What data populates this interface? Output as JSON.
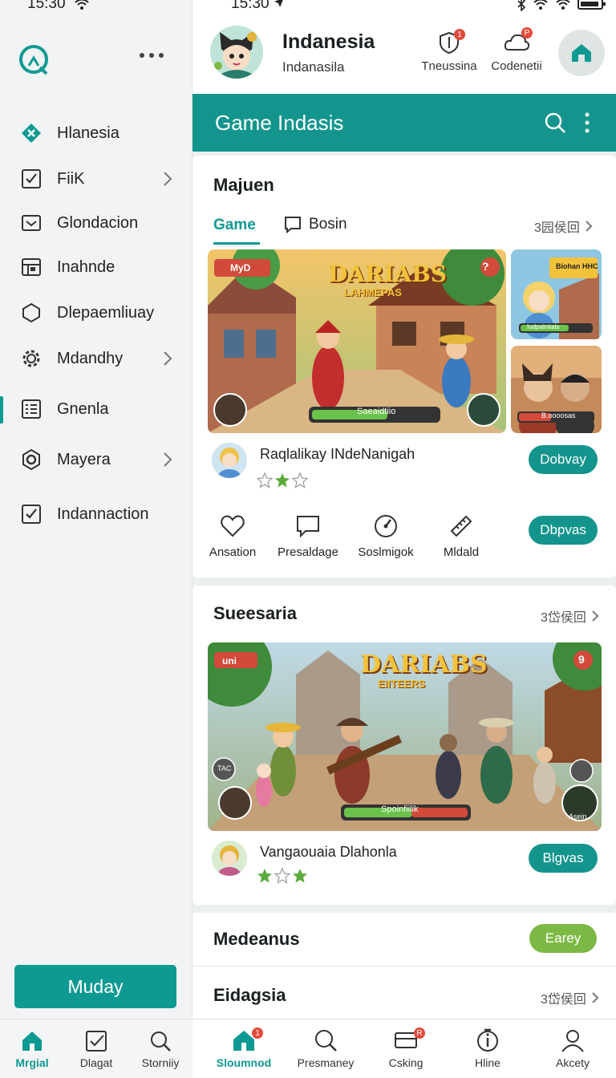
{
  "status_left": {
    "time": "15:30"
  },
  "status_right": {
    "time": "15:30"
  },
  "sidebar": {
    "items": [
      {
        "label": "Hlanesia",
        "icon": "puzzle-icon"
      },
      {
        "label": "FiiK",
        "icon": "checkbox-icon"
      },
      {
        "label": "Glondacion",
        "icon": "inbox-icon"
      },
      {
        "label": "Inahnde",
        "icon": "layout-icon"
      },
      {
        "label": "Dlepaemliuay",
        "icon": "hexagon-icon"
      },
      {
        "label": "Mdandhy",
        "icon": "gear-icon"
      },
      {
        "label": "Gnenla",
        "icon": "list-icon"
      },
      {
        "label": "Mayera",
        "icon": "settings-icon"
      },
      {
        "label": "Indannaction",
        "icon": "checkbox-icon"
      }
    ],
    "cta": "Muday"
  },
  "left_bottom_nav": [
    {
      "label": "Mrgial",
      "icon": "home-icon"
    },
    {
      "label": "Dlagat",
      "icon": "check-square-icon"
    },
    {
      "label": "Storniiy",
      "icon": "search-icon"
    }
  ],
  "header": {
    "title": "Indanesia",
    "subtitle": "Indanasila",
    "actions": [
      {
        "label": "Tneussina",
        "icon": "shield-icon",
        "badge": "1"
      },
      {
        "label": "Codenetii",
        "icon": "cloud-icon",
        "badge": "P"
      }
    ],
    "home_icon": "home-icon"
  },
  "section_bar": {
    "title": "Game Indasis"
  },
  "card1": {
    "title": "Majuen",
    "tabs": [
      {
        "label": "Game"
      },
      {
        "label": "Bosin"
      }
    ],
    "more": "3园侯回",
    "banner": {
      "logo": "DARIABS",
      "logo_sub": "LAHMEPAS",
      "progress_label": "Saeaidtiio",
      "progress": 0.6,
      "corner_tag": "MyD",
      "corner_num": "?"
    },
    "thumb1": {
      "title": "Biohan HHC",
      "bar_label": "Iodpalnitals"
    },
    "thumb2": {
      "bar_label": "B.oooosas"
    },
    "row": {
      "name": "Raqlalikay INdeNanigah",
      "button": "Dobvay",
      "stars_filled": 1,
      "stars_total": 3
    },
    "actions": [
      {
        "label": "Ansation",
        "icon": "heart-icon"
      },
      {
        "label": "Presaldage",
        "icon": "chat-icon"
      },
      {
        "label": "Soslmigok",
        "icon": "gauge-icon"
      },
      {
        "label": "Mldald",
        "icon": "ruler-icon"
      }
    ],
    "action_button": "Dbpvas"
  },
  "card2": {
    "title": "Sueesaria",
    "more": "3岱侯回",
    "banner": {
      "logo": "DARIABS",
      "logo_sub": "EIITEERS",
      "progress_label": "Spoinfiilik",
      "progress": 0.55,
      "tag": "uni",
      "corner_num": "9",
      "badge_text": "Asein",
      "tfc": "TAC"
    },
    "row": {
      "name": "Vangaouaia Dlahonla",
      "button": "Blgvas",
      "stars_filled": 2,
      "stars_total": 3
    }
  },
  "card3": {
    "row1": {
      "title": "Medeanus",
      "button": "Earey"
    },
    "row2": {
      "title": "Eidagsia",
      "more": "3岱侯回"
    }
  },
  "bottom_nav": [
    {
      "label": "Sloumnod",
      "icon": "home-icon",
      "active": true,
      "badge": "1"
    },
    {
      "label": "Presmaney",
      "icon": "search-icon"
    },
    {
      "label": "Csking",
      "icon": "message-icon",
      "badge": "R"
    },
    {
      "label": "Hline",
      "icon": "info-icon"
    },
    {
      "label": "Akcety",
      "icon": "user-icon"
    }
  ],
  "colors": {
    "accent": "#13958d",
    "green": "#7cb944",
    "badge": "#e34a3a"
  }
}
